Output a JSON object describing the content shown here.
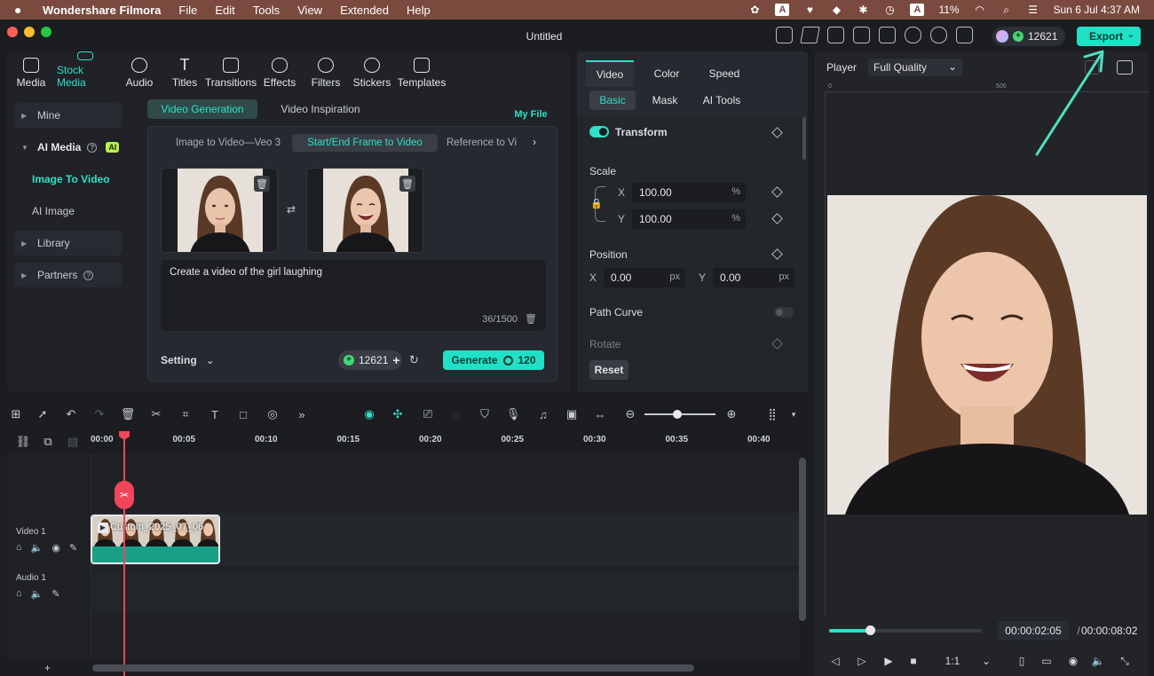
{
  "menubar": {
    "app_name": "Wondershare Filmora",
    "items": [
      "File",
      "Edit",
      "Tools",
      "View",
      "Extended",
      "Help"
    ],
    "battery": "11%",
    "datetime": "Sun 6 Jul  4:37 AM",
    "input_badge": "A"
  },
  "window": {
    "title": "Untitled"
  },
  "toolbar": {
    "credits": "12621",
    "export_label": "Export"
  },
  "media_tabs": [
    {
      "label": "Media"
    },
    {
      "label": "Stock Media"
    },
    {
      "label": "Audio"
    },
    {
      "label": "Titles"
    },
    {
      "label": "Transitions"
    },
    {
      "label": "Effects"
    },
    {
      "label": "Filters"
    },
    {
      "label": "Stickers"
    },
    {
      "label": "Templates"
    }
  ],
  "sidebar": {
    "mine": "Mine",
    "ai_media": "AI Media",
    "ai_badge": "AI",
    "image_to_video": "Image To Video",
    "ai_image": "AI Image",
    "library": "Library",
    "partners": "Partners"
  },
  "content": {
    "tab_generation": "Video Generation",
    "tab_inspiration": "Video Inspiration",
    "my_file": "My File",
    "card_tabs": [
      "Image to Video—Veo 3",
      "Start/End Frame to Video",
      "Reference to Vi"
    ],
    "prompt": "Create a video of the girl laughing",
    "counter": "36/1500",
    "setting": "Setting",
    "credits": "12621",
    "generate_label": "Generate",
    "generate_cost": "120"
  },
  "props": {
    "tabs": [
      "Video",
      "Color",
      "Speed"
    ],
    "subtabs": [
      "Basic",
      "Mask",
      "AI Tools"
    ],
    "transform": "Transform",
    "scale": "Scale",
    "x_label": "X",
    "y_label": "Y",
    "scale_x": "100.00",
    "scale_y": "100.00",
    "percent": "%",
    "position": "Position",
    "pos_x": "0.00",
    "pos_y": "0.00",
    "px": "px",
    "path_curve": "Path Curve",
    "rotate": "Rotate",
    "reset": "Reset"
  },
  "player": {
    "label": "Player",
    "quality": "Full Quality",
    "ruler_0": "0",
    "ruler_500": "500",
    "current_time": "00:00:02:05",
    "separator": "/",
    "total_time": "00:00:08:02",
    "ratio": "1:1",
    "progress": 0.27
  },
  "timeline": {
    "ticks": [
      "00:00",
      "00:05",
      "00:10",
      "00:15",
      "00:20",
      "00:25",
      "00:30",
      "00:35",
      "00:40"
    ],
    "video_track": "Video 1",
    "audio_track": "Audio 1",
    "clip_name": "Custom_2025_07_06",
    "add": "+"
  },
  "colors": {
    "accent": "#20e0c5",
    "playhead": "#f0455a",
    "menubar": "#7a4a3e",
    "ai_badge": "#b9f24d"
  }
}
